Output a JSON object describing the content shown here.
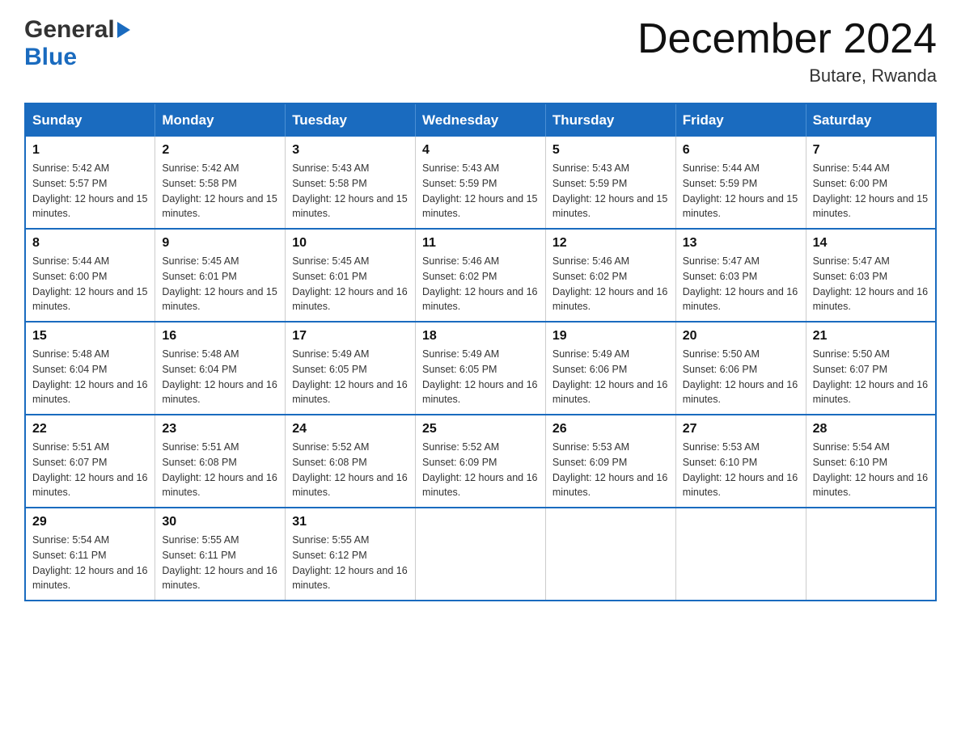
{
  "header": {
    "logo_general": "General",
    "logo_blue": "Blue",
    "title": "December 2024",
    "location": "Butare, Rwanda"
  },
  "calendar": {
    "days_of_week": [
      "Sunday",
      "Monday",
      "Tuesday",
      "Wednesday",
      "Thursday",
      "Friday",
      "Saturday"
    ],
    "weeks": [
      [
        {
          "date": "1",
          "sunrise": "5:42 AM",
          "sunset": "5:57 PM",
          "daylight": "12 hours and 15 minutes."
        },
        {
          "date": "2",
          "sunrise": "5:42 AM",
          "sunset": "5:58 PM",
          "daylight": "12 hours and 15 minutes."
        },
        {
          "date": "3",
          "sunrise": "5:43 AM",
          "sunset": "5:58 PM",
          "daylight": "12 hours and 15 minutes."
        },
        {
          "date": "4",
          "sunrise": "5:43 AM",
          "sunset": "5:59 PM",
          "daylight": "12 hours and 15 minutes."
        },
        {
          "date": "5",
          "sunrise": "5:43 AM",
          "sunset": "5:59 PM",
          "daylight": "12 hours and 15 minutes."
        },
        {
          "date": "6",
          "sunrise": "5:44 AM",
          "sunset": "5:59 PM",
          "daylight": "12 hours and 15 minutes."
        },
        {
          "date": "7",
          "sunrise": "5:44 AM",
          "sunset": "6:00 PM",
          "daylight": "12 hours and 15 minutes."
        }
      ],
      [
        {
          "date": "8",
          "sunrise": "5:44 AM",
          "sunset": "6:00 PM",
          "daylight": "12 hours and 15 minutes."
        },
        {
          "date": "9",
          "sunrise": "5:45 AM",
          "sunset": "6:01 PM",
          "daylight": "12 hours and 15 minutes."
        },
        {
          "date": "10",
          "sunrise": "5:45 AM",
          "sunset": "6:01 PM",
          "daylight": "12 hours and 16 minutes."
        },
        {
          "date": "11",
          "sunrise": "5:46 AM",
          "sunset": "6:02 PM",
          "daylight": "12 hours and 16 minutes."
        },
        {
          "date": "12",
          "sunrise": "5:46 AM",
          "sunset": "6:02 PM",
          "daylight": "12 hours and 16 minutes."
        },
        {
          "date": "13",
          "sunrise": "5:47 AM",
          "sunset": "6:03 PM",
          "daylight": "12 hours and 16 minutes."
        },
        {
          "date": "14",
          "sunrise": "5:47 AM",
          "sunset": "6:03 PM",
          "daylight": "12 hours and 16 minutes."
        }
      ],
      [
        {
          "date": "15",
          "sunrise": "5:48 AM",
          "sunset": "6:04 PM",
          "daylight": "12 hours and 16 minutes."
        },
        {
          "date": "16",
          "sunrise": "5:48 AM",
          "sunset": "6:04 PM",
          "daylight": "12 hours and 16 minutes."
        },
        {
          "date": "17",
          "sunrise": "5:49 AM",
          "sunset": "6:05 PM",
          "daylight": "12 hours and 16 minutes."
        },
        {
          "date": "18",
          "sunrise": "5:49 AM",
          "sunset": "6:05 PM",
          "daylight": "12 hours and 16 minutes."
        },
        {
          "date": "19",
          "sunrise": "5:49 AM",
          "sunset": "6:06 PM",
          "daylight": "12 hours and 16 minutes."
        },
        {
          "date": "20",
          "sunrise": "5:50 AM",
          "sunset": "6:06 PM",
          "daylight": "12 hours and 16 minutes."
        },
        {
          "date": "21",
          "sunrise": "5:50 AM",
          "sunset": "6:07 PM",
          "daylight": "12 hours and 16 minutes."
        }
      ],
      [
        {
          "date": "22",
          "sunrise": "5:51 AM",
          "sunset": "6:07 PM",
          "daylight": "12 hours and 16 minutes."
        },
        {
          "date": "23",
          "sunrise": "5:51 AM",
          "sunset": "6:08 PM",
          "daylight": "12 hours and 16 minutes."
        },
        {
          "date": "24",
          "sunrise": "5:52 AM",
          "sunset": "6:08 PM",
          "daylight": "12 hours and 16 minutes."
        },
        {
          "date": "25",
          "sunrise": "5:52 AM",
          "sunset": "6:09 PM",
          "daylight": "12 hours and 16 minutes."
        },
        {
          "date": "26",
          "sunrise": "5:53 AM",
          "sunset": "6:09 PM",
          "daylight": "12 hours and 16 minutes."
        },
        {
          "date": "27",
          "sunrise": "5:53 AM",
          "sunset": "6:10 PM",
          "daylight": "12 hours and 16 minutes."
        },
        {
          "date": "28",
          "sunrise": "5:54 AM",
          "sunset": "6:10 PM",
          "daylight": "12 hours and 16 minutes."
        }
      ],
      [
        {
          "date": "29",
          "sunrise": "5:54 AM",
          "sunset": "6:11 PM",
          "daylight": "12 hours and 16 minutes."
        },
        {
          "date": "30",
          "sunrise": "5:55 AM",
          "sunset": "6:11 PM",
          "daylight": "12 hours and 16 minutes."
        },
        {
          "date": "31",
          "sunrise": "5:55 AM",
          "sunset": "6:12 PM",
          "daylight": "12 hours and 16 minutes."
        },
        null,
        null,
        null,
        null
      ]
    ]
  }
}
